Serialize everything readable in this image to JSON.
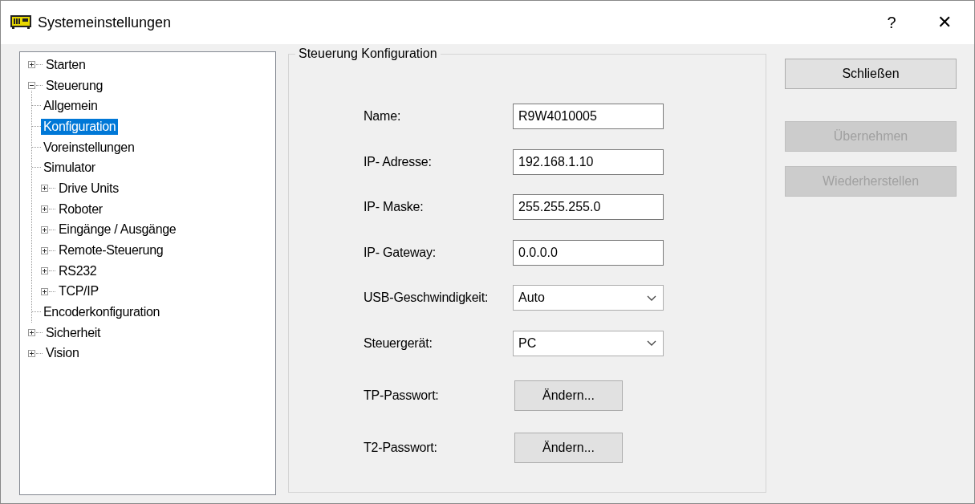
{
  "window": {
    "title": "Systemeinstellungen",
    "help": "?",
    "close": "✕"
  },
  "tree": [
    {
      "label": "Starten",
      "expanded": false,
      "selected": false
    },
    {
      "label": "Steuerung",
      "expanded": true,
      "selected": false,
      "children": [
        {
          "label": "Allgemein",
          "selected": false
        },
        {
          "label": "Konfiguration",
          "selected": true
        },
        {
          "label": "Voreinstellungen",
          "selected": false
        },
        {
          "label": "Simulator",
          "selected": false
        },
        {
          "label": "Drive Units",
          "expanded": false,
          "selected": false
        },
        {
          "label": "Roboter",
          "expanded": false,
          "selected": false
        },
        {
          "label": "Eingänge / Ausgänge",
          "expanded": false,
          "selected": false
        },
        {
          "label": "Remote-Steuerung",
          "expanded": false,
          "selected": false
        },
        {
          "label": "RS232",
          "expanded": false,
          "selected": false
        },
        {
          "label": "TCP/IP",
          "expanded": false,
          "selected": false
        },
        {
          "label": "Encoderkonfiguration",
          "selected": false
        }
      ]
    },
    {
      "label": "Sicherheit",
      "expanded": false,
      "selected": false
    },
    {
      "label": "Vision",
      "expanded": false,
      "selected": false
    }
  ],
  "group": {
    "title": "Steuerung Konfiguration",
    "rows": [
      {
        "kind": "text",
        "label": "Name:",
        "value": "R9W4010005"
      },
      {
        "kind": "text",
        "label": "IP- Adresse:",
        "value": "192.168.1.10"
      },
      {
        "kind": "text",
        "label": "IP- Maske:",
        "value": "255.255.255.0"
      },
      {
        "kind": "text",
        "label": "IP- Gateway:",
        "value": "0.0.0.0"
      },
      {
        "kind": "select",
        "label": "USB-Geschwindigkeit:",
        "value": "Auto"
      },
      {
        "kind": "select",
        "label": "Steuergerät:",
        "value": "PC"
      },
      {
        "kind": "button",
        "label": "TP-Passwort:",
        "value": "Ändern..."
      },
      {
        "kind": "button",
        "label": "T2-Passwort:",
        "value": "Ändern..."
      }
    ]
  },
  "buttons": [
    {
      "label": "Schließen",
      "disabled": false
    },
    {
      "label": "Übernehmen",
      "disabled": true
    },
    {
      "label": "Wiederherstellen",
      "disabled": true
    }
  ]
}
